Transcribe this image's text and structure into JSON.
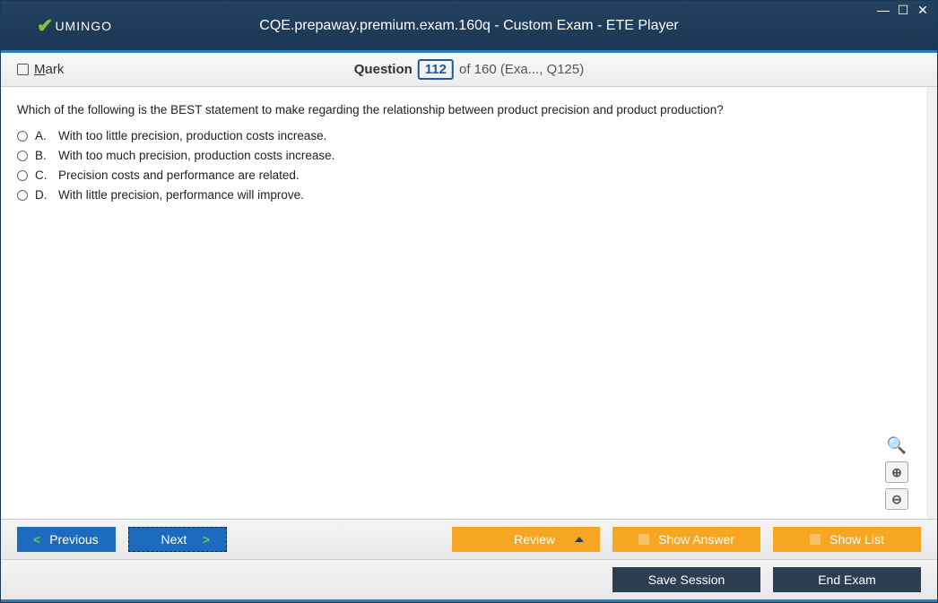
{
  "header": {
    "logo_text": "UMINGO",
    "title": "CQE.prepaway.premium.exam.160q - Custom Exam - ETE Player"
  },
  "question_bar": {
    "mark_label": "Mark",
    "question_label": "Question",
    "current_number": "112",
    "of_text": "of 160 (Exa..., Q125)"
  },
  "question": {
    "text": "Which of the following is the BEST statement to make regarding the relationship between product precision and product production?",
    "options": [
      {
        "letter": "A.",
        "text": "With too little precision, production costs increase."
      },
      {
        "letter": "B.",
        "text": "With too much precision, production costs increase."
      },
      {
        "letter": "C.",
        "text": "Precision costs and performance are related."
      },
      {
        "letter": "D.",
        "text": "With little precision, performance will improve."
      }
    ]
  },
  "nav": {
    "previous": "Previous",
    "next": "Next",
    "review": "Review",
    "show_answer": "Show Answer",
    "show_list": "Show List"
  },
  "bottom": {
    "save_session": "Save Session",
    "end_exam": "End Exam"
  }
}
